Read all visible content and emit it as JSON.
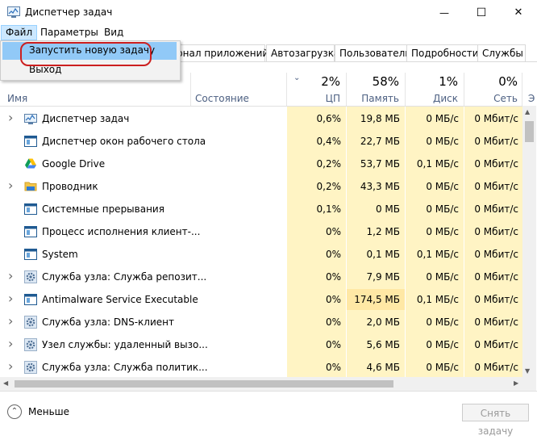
{
  "window": {
    "title": "Диспетчер задач",
    "minimize": "—",
    "maximize": "☐",
    "close": "✕"
  },
  "menu": {
    "file": "Файл",
    "options": "Параметры",
    "view": "Вид"
  },
  "file_menu": {
    "run_new_task": "Запустить новую задачу",
    "exit": "Выход"
  },
  "tabs": [
    "рнал приложений",
    "Автозагрузка",
    "Пользователи",
    "Подробности",
    "Службы"
  ],
  "columns": {
    "name": "Имя",
    "status": "Состояние",
    "cpu": {
      "pct": "2%",
      "label": "ЦП"
    },
    "memory": {
      "pct": "58%",
      "label": "Память"
    },
    "disk": {
      "pct": "1%",
      "label": "Диск"
    },
    "network": {
      "pct": "0%",
      "label": "Сеть"
    },
    "more": "Э"
  },
  "processes": [
    {
      "name": "Диспетчер задач",
      "icon": "task-manager-icon",
      "expand": true,
      "cpu": "0,6%",
      "mem": "19,8 МБ",
      "disk": "0 МБ/с",
      "net": "0 Мбит/с"
    },
    {
      "name": "Диспетчер окон рабочего стола",
      "icon": "app-window-icon",
      "expand": false,
      "cpu": "0,4%",
      "mem": "22,7 МБ",
      "disk": "0 МБ/с",
      "net": "0 Мбит/с"
    },
    {
      "name": "Google Drive",
      "icon": "google-drive-icon",
      "expand": false,
      "cpu": "0,2%",
      "mem": "53,7 МБ",
      "disk": "0,1 МБ/с",
      "net": "0 Мбит/с"
    },
    {
      "name": "Проводник",
      "icon": "folder-icon",
      "expand": true,
      "cpu": "0,2%",
      "mem": "43,3 МБ",
      "disk": "0 МБ/с",
      "net": "0 Мбит/с"
    },
    {
      "name": "Системные прерывания",
      "icon": "app-window-icon",
      "expand": false,
      "cpu": "0,1%",
      "mem": "0 МБ",
      "disk": "0 МБ/с",
      "net": "0 Мбит/с"
    },
    {
      "name": "Процесс исполнения клиент-...",
      "icon": "app-window-icon",
      "expand": false,
      "cpu": "0%",
      "mem": "1,2 МБ",
      "disk": "0 МБ/с",
      "net": "0 Мбит/с"
    },
    {
      "name": "System",
      "icon": "app-window-icon",
      "expand": false,
      "cpu": "0%",
      "mem": "0,1 МБ",
      "disk": "0,1 МБ/с",
      "net": "0 Мбит/с"
    },
    {
      "name": "Служба узла: Служба репозит...",
      "icon": "gear-icon",
      "expand": true,
      "cpu": "0%",
      "mem": "7,9 МБ",
      "disk": "0 МБ/с",
      "net": "0 Мбит/с"
    },
    {
      "name": "Antimalware Service Executable",
      "icon": "app-window-icon",
      "expand": true,
      "cpu": "0%",
      "mem": "174,5 МБ",
      "disk": "0,1 МБ/с",
      "net": "0 Мбит/с"
    },
    {
      "name": "Служба узла: DNS-клиент",
      "icon": "gear-icon",
      "expand": true,
      "cpu": "0%",
      "mem": "2,0 МБ",
      "disk": "0 МБ/с",
      "net": "0 Мбит/с"
    },
    {
      "name": "Узел службы: удаленный вызо...",
      "icon": "gear-icon",
      "expand": true,
      "cpu": "0%",
      "mem": "5,6 МБ",
      "disk": "0 МБ/с",
      "net": "0 Мбит/с"
    },
    {
      "name": "Служба узла: Служба политик...",
      "icon": "gear-icon",
      "expand": true,
      "cpu": "0%",
      "mem": "4,6 МБ",
      "disk": "0 МБ/с",
      "net": "0 Мбит/с"
    }
  ],
  "footer": {
    "fewer": "Меньше",
    "end_task": "Снять задачу"
  },
  "colors": {
    "heat_light": "#fff4c4",
    "heat_medium": "#ffe8a5",
    "selection": "#91c9f7",
    "highlight": "#cc1f1f"
  }
}
